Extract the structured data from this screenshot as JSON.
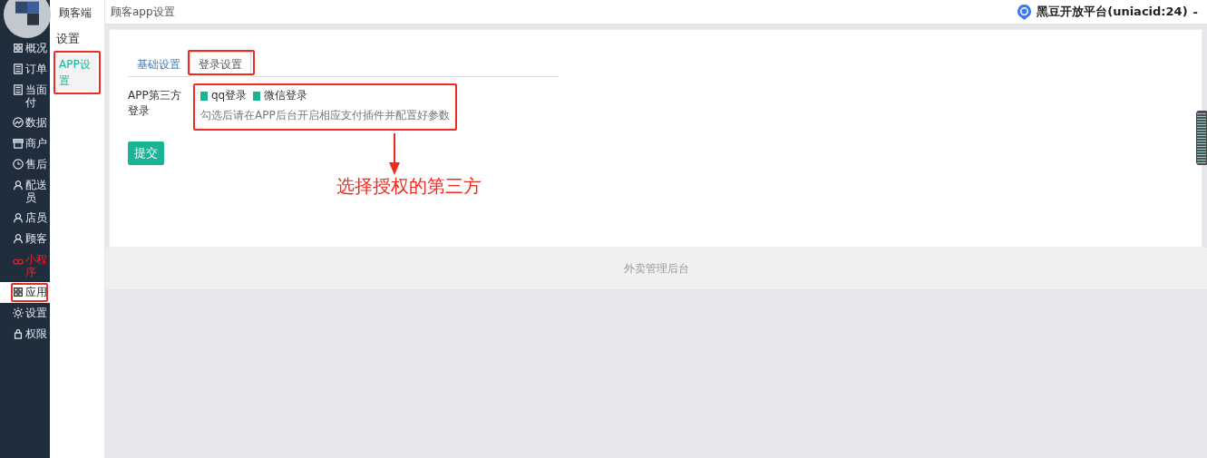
{
  "nav": {
    "items": [
      {
        "label": "概况",
        "selected": false,
        "highlighted": false
      },
      {
        "label": "订单",
        "selected": false,
        "highlighted": false
      },
      {
        "label": "当面付",
        "selected": false,
        "highlighted": false
      },
      {
        "label": "数据",
        "selected": false,
        "highlighted": false
      },
      {
        "label": "商户",
        "selected": false,
        "highlighted": false
      },
      {
        "label": "售后",
        "selected": false,
        "highlighted": false
      },
      {
        "label": "配送员",
        "selected": false,
        "highlighted": false
      },
      {
        "label": "店员",
        "selected": false,
        "highlighted": false
      },
      {
        "label": "顾客",
        "selected": false,
        "highlighted": false
      },
      {
        "label": "小程序",
        "selected": false,
        "highlighted": true
      },
      {
        "label": "应用",
        "selected": true,
        "highlighted": false
      },
      {
        "label": "设置",
        "selected": false,
        "highlighted": false
      },
      {
        "label": "权限",
        "selected": false,
        "highlighted": false
      }
    ]
  },
  "subnav": {
    "header": "顾客端",
    "section": "设置",
    "items": [
      {
        "label": "APP设置",
        "selected": true
      }
    ]
  },
  "topbar": {
    "title": "顾客app设置",
    "account": "黑豆开放平台(uniacid:24)",
    "caret": "-"
  },
  "tabs": [
    {
      "label": "基础设置",
      "selected": false
    },
    {
      "label": "登录设置",
      "selected": true
    }
  ],
  "form": {
    "label": "APP第三方登录",
    "options": [
      {
        "label": "qq登录",
        "checked": true
      },
      {
        "label": "微信登录",
        "checked": true
      }
    ],
    "hint": "勾选后请在APP后台开启相应支付插件并配置好参数",
    "submit": "提交"
  },
  "annotation": {
    "caption": "选择授权的第三方"
  },
  "footer": "外卖管理后台"
}
